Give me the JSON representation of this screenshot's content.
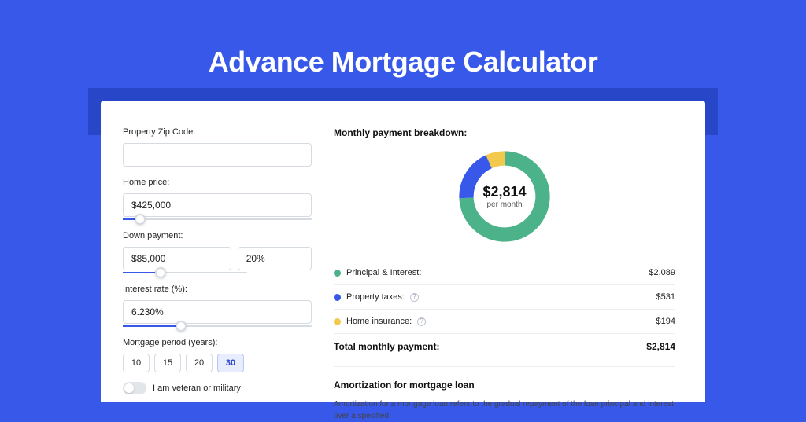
{
  "title": "Advance Mortgage Calculator",
  "form": {
    "zip_label": "Property Zip Code:",
    "zip_value": "",
    "home_price_label": "Home price:",
    "home_price_value": "$425,000",
    "home_price_slider_pct": 9,
    "down_payment_label": "Down payment:",
    "down_payment_value": "$85,000",
    "down_payment_pct_value": "20%",
    "down_payment_slider_pct": 20,
    "interest_label": "Interest rate (%):",
    "interest_value": "6.230%",
    "interest_slider_pct": 31,
    "period_label": "Mortgage period (years):",
    "period_options": [
      "10",
      "15",
      "20",
      "30"
    ],
    "period_selected": "30",
    "vet_label": "I am veteran or military"
  },
  "breakdown": {
    "title": "Monthly payment breakdown:",
    "center_amount": "$2,814",
    "center_sub": "per month",
    "items": [
      {
        "label": "Principal & Interest:",
        "value": "$2,089",
        "color": "#4bb28a",
        "info": false
      },
      {
        "label": "Property taxes:",
        "value": "$531",
        "color": "#3758e9",
        "info": true
      },
      {
        "label": "Home insurance:",
        "value": "$194",
        "color": "#f2c94c",
        "info": true
      }
    ],
    "total_label": "Total monthly payment:",
    "total_value": "$2,814"
  },
  "amort": {
    "title": "Amortization for mortgage loan",
    "text": "Amortization for a mortgage loan refers to the gradual repayment of the loan principal and interest over a specified"
  },
  "chart_data": {
    "type": "pie",
    "title": "Monthly payment breakdown",
    "series": [
      {
        "name": "Principal & Interest",
        "value": 2089,
        "color": "#4bb28a"
      },
      {
        "name": "Property taxes",
        "value": 531,
        "color": "#3758e9"
      },
      {
        "name": "Home insurance",
        "value": 194,
        "color": "#f2c94c"
      }
    ],
    "total": 2814,
    "center_label": "$2,814 per month"
  }
}
